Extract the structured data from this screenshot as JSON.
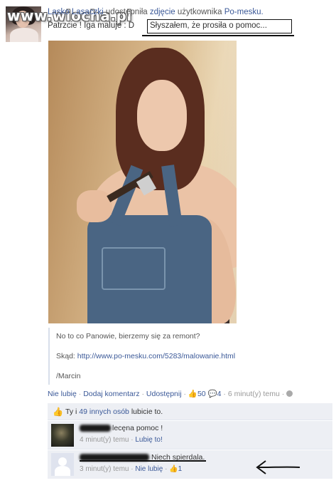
{
  "watermark": "www.wiocha.pl",
  "post": {
    "author": "Lasko Lasaczki",
    "verb": "udostępniła",
    "object_link": "zdjęcie",
    "owner_prefix": "użytkownika",
    "owner": "Po-mesku.",
    "status_start": "Patrzcie ! Iga maluje : D",
    "status_boxed": "Słyszałem, że prosiła o pomoc..."
  },
  "attachment": {
    "caption": "No to co Panowie, bierzemy się za remont?",
    "source_label": "Skąd:",
    "source_url": "http://www.po-mesku.com/5283/malowanie.html",
    "signature": "/Marcin"
  },
  "actions": {
    "unlike": "Nie lubię",
    "add_comment": "Dodaj komentarz",
    "share": "Udostępnij",
    "likes_count": "50",
    "comments_count": "4",
    "time": "6 minut(y) temu"
  },
  "likes_summary": {
    "prefix": "Ty i",
    "others_link": "49 innych osób",
    "suffix": "lubicie to."
  },
  "comments": [
    {
      "text": "lecęna pomoc !",
      "time": "4 minut(y) temu",
      "like_link": "Lubię to!"
    },
    {
      "text": "Niech spierdala.",
      "time": "3 minut(y) temu",
      "unlike_link": "Nie lubię",
      "likes": "1"
    }
  ],
  "colors": {
    "link": "#3b5998",
    "panel": "#edeff4"
  }
}
